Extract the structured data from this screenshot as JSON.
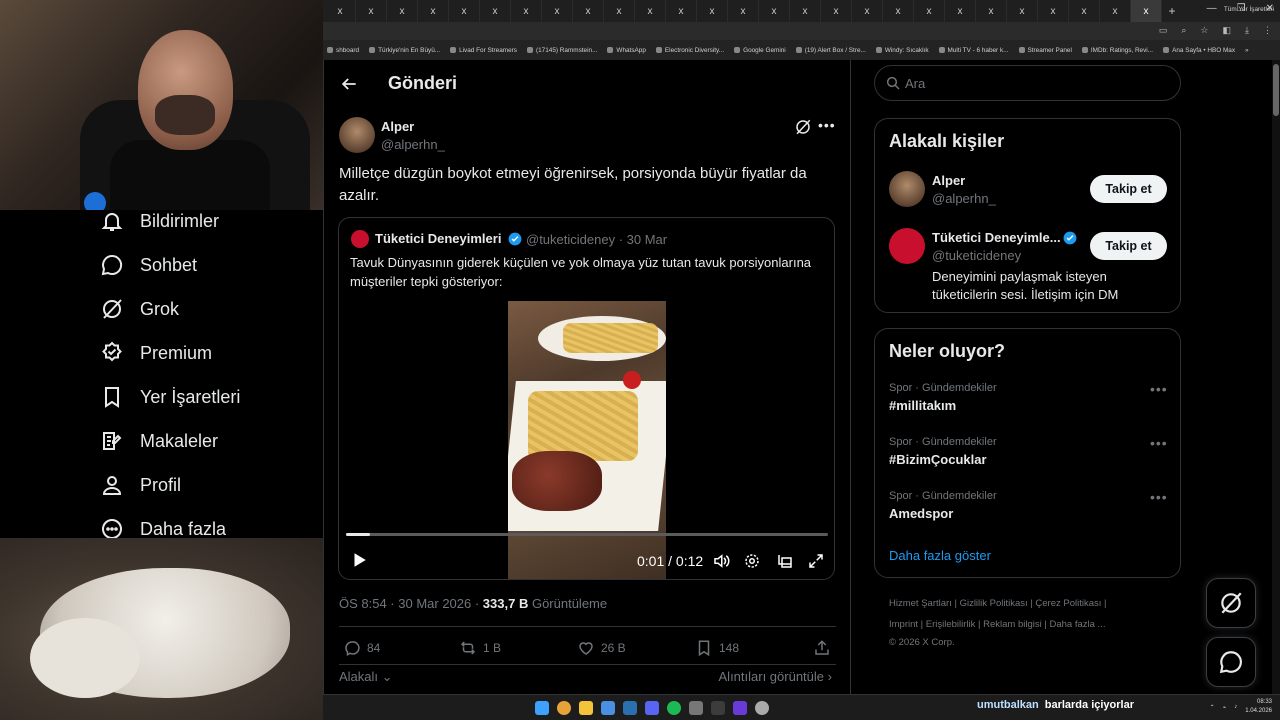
{
  "browser": {
    "tabs": [
      "x",
      "x",
      "x",
      "x",
      "x",
      "x",
      "x",
      "x",
      "x",
      "x",
      "x",
      "x",
      "x",
      "x",
      "x",
      "x",
      "x",
      "x",
      "x",
      "x",
      "x",
      "x",
      "x",
      "x",
      "x",
      "x",
      "x"
    ],
    "new_tab": "+",
    "bookmarks": [
      "shboard",
      "Türkiye'nin En Büyü...",
      "Livad For Streamers",
      "(17145) Rammstein...",
      "WhatsApp",
      "Electronic Diversity...",
      "Google Gemini",
      "(19) Alert Box / Stre...",
      "Windy: Sıcaklık",
      "Multi TV - 6 haber k...",
      "Streamer Panel",
      "IMDb: Ratings, Revi...",
      "Ana Sayfa • HBO Max"
    ],
    "bookmarks_overflow": "»",
    "all_bookmarks": "Tüm Yer İşaretleri"
  },
  "sidebar": {
    "items": [
      {
        "label": "Bildirimler",
        "icon": "bell-icon"
      },
      {
        "label": "Sohbet",
        "icon": "chat-icon"
      },
      {
        "label": "Grok",
        "icon": "grok-icon"
      },
      {
        "label": "Premium",
        "icon": "premium-icon"
      },
      {
        "label": "Yer İşaretleri",
        "icon": "bookmark-icon"
      },
      {
        "label": "Makaleler",
        "icon": "article-icon"
      },
      {
        "label": "Profil",
        "icon": "profile-icon"
      },
      {
        "label": "Daha fazla",
        "icon": "more-circle-icon"
      }
    ]
  },
  "header": {
    "title": "Gönderi"
  },
  "post": {
    "author_name": "Alper",
    "author_handle": "@alperhn_",
    "text": "Milletçe düzgün boykot etmeyi öğrenirsek, porsiyonda büyür fiyatlar da azalır.",
    "quote": {
      "name": "Tüketici Deneyimleri",
      "handle": "@tuketicideney · 30 Mar",
      "text": "Tavuk Dünyasının giderek küçülen ve yok olmaya yüz tutan tavuk porsiyonlarına müşteriler tepki gösteriyor:",
      "video_time": "0:01 / 0:12",
      "video_progress": 0.05
    },
    "meta_time": "ÖS 8:54 · 30 Mar 2026 · ",
    "meta_views": "333,7 B",
    "meta_views_label": " Görüntüleme",
    "replies": "84",
    "reposts": "1 B",
    "likes": "26 B",
    "bookmarks": "148",
    "related_label": "Alakalı",
    "quotes_link": "Alıntıları görüntüle"
  },
  "right": {
    "search_placeholder": "Ara",
    "related_people_title": "Alakalı kişiler",
    "people": [
      {
        "name": "Alper",
        "handle": "@alperhn_",
        "button": "Takip et",
        "bio": ""
      },
      {
        "name": "Tüketici Deneyimle...",
        "handle": "@tuketicideney",
        "button": "Takip et",
        "bio": "Deneyimini paylaşmak isteyen tüketicilerin sesi. İletişim için DM"
      }
    ],
    "trends_title": "Neler oluyor?",
    "trends": [
      {
        "meta": "Spor · Gündemdekiler",
        "name": "#millitakım"
      },
      {
        "meta": "Spor · Gündemdekiler",
        "name": "#BizimÇocuklar"
      },
      {
        "meta": "Spor · Gündemdekiler",
        "name": "Amedspor"
      }
    ],
    "show_more": "Daha fazla göster",
    "footer_line1": "Hizmet Şartları  |  Gizlilik Politikası  |  Çerez Politikası  |",
    "footer_line2": "Imprint  |  Erişilebilirlik  |  Reklam bilgisi  |  Daha fazla ...",
    "footer_line3": "© 2026 X Corp."
  },
  "overlay": {
    "chat_user": "umutbalkan",
    "chat_message": "barlarda içiyorlar"
  },
  "taskbar": {
    "time": "08:33",
    "date": "1.04.2026"
  },
  "colors": {
    "accent": "#1d9bf0",
    "background": "#000000",
    "border": "#2f3336",
    "muted": "#71767b"
  }
}
